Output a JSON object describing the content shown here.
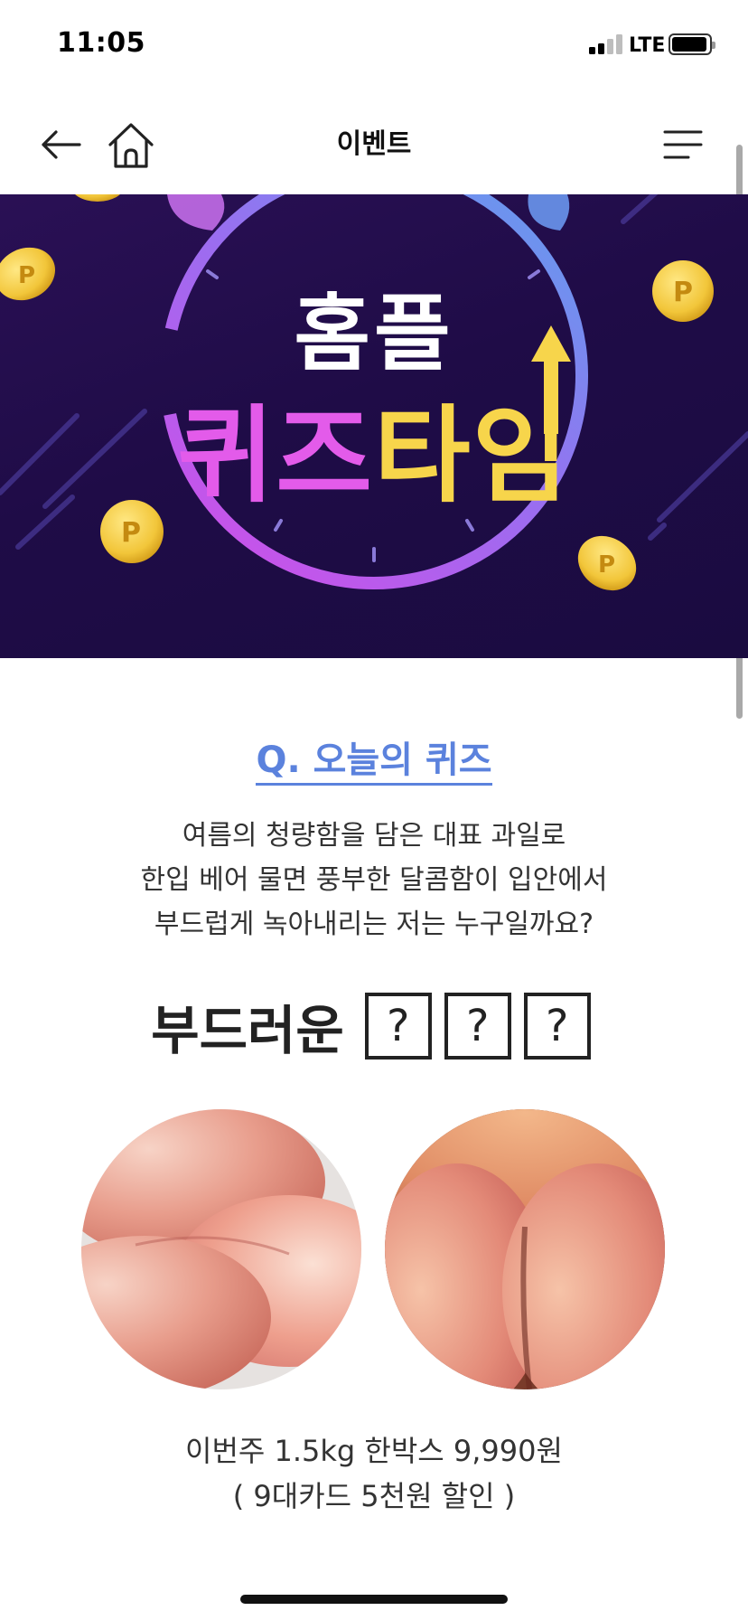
{
  "status_bar": {
    "time": "11:05",
    "network": "LTE"
  },
  "nav": {
    "title": "이벤트"
  },
  "banner": {
    "line1": "홈플",
    "line2_part1": "퀴즈",
    "line2_part2": "타임",
    "coin_symbol": "P"
  },
  "quiz": {
    "title": "Q. 오늘의 퀴즈",
    "question_lines": [
      "여름의 청량함을 담은 대표 과일로",
      "한입 베어 물면 풍부한 달콤함이 입안에서",
      "부드럽게 녹아내리는 저는 누구일까요?"
    ],
    "answer_prefix": "부드러운",
    "answer_boxes": [
      "?",
      "?",
      "?"
    ]
  },
  "price": {
    "line1": "이번주 1.5kg 한박스 9,990원",
    "line2": "( 9대카드 5천원 할인 )"
  },
  "colors": {
    "banner_bg": "#211049",
    "banner_magenta": "#e35bea",
    "banner_gold": "#f7d54b",
    "quiz_title": "#5b82dd",
    "coin": "#f2c63a"
  }
}
